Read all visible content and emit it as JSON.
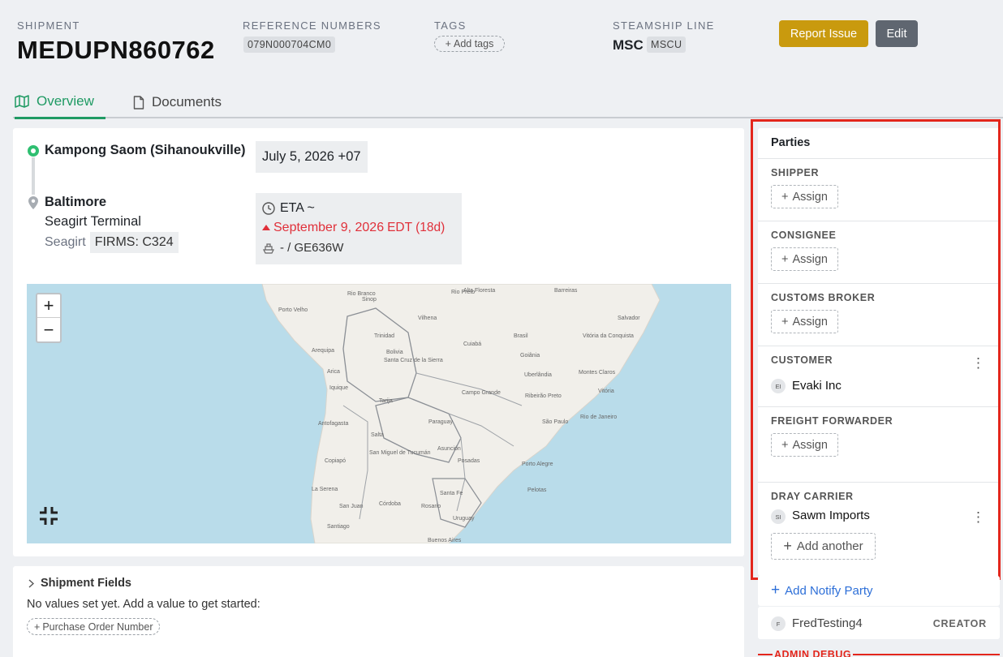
{
  "header": {
    "shipment_label": "SHIPMENT",
    "shipment_number": "MEDUPN860762",
    "reference_label": "REFERENCE NUMBERS",
    "reference_value": "079N000704CM0",
    "tags_label": "TAGS",
    "add_tags": "Add tags",
    "steamship_label": "STEAMSHIP LINE",
    "steamship_name": "MSC",
    "steamship_code": "MSCU",
    "report_button": "Report Issue",
    "edit_button": "Edit"
  },
  "tabs": [
    {
      "label": "Overview",
      "icon": "map-icon",
      "active": true
    },
    {
      "label": "Documents",
      "icon": "document-icon",
      "active": false
    }
  ],
  "route": {
    "origin": "Kampong Saom (Sihanoukville)",
    "departure_date": "July 5, 2026 +07",
    "destination": "Baltimore",
    "terminal": "Seagirt Terminal",
    "terminal_short": "Seagirt",
    "firms": "FIRMS: C324",
    "eta_label": "ETA ~",
    "eta_date": "September 9, 2026",
    "eta_tz_delay": "EDT (18d)",
    "vessel": "- / GE636W",
    "colors": {
      "origin": "#2fbf71",
      "delay": "#e0303a"
    }
  },
  "map": {
    "zoom_in": "+",
    "zoom_out": "−",
    "labels": [
      "Rio Branco",
      "Porto Velho",
      "Rio Preto",
      "Alta Floresta",
      "Barreiras",
      "Salvador",
      "Sinop",
      "Vilhena",
      "Brasil",
      "Vitória da Conquista",
      "Trinidad",
      "Cuiabá",
      "Goiânia",
      "Montes Claros",
      "Bolivia",
      "Santa Cruz de la Sierra",
      "Uberlândia",
      "Arequipa",
      "Arica",
      "Campo Grande",
      "Ribeirão Preto",
      "Vitória",
      "Iquique",
      "Tarija",
      "Rio de Janeiro",
      "Antofagasta",
      "Paraguay",
      "São Paulo",
      "Salta",
      "Asunción",
      "Copiapó",
      "San Miguel de Tucumán",
      "Posadas",
      "Porto Alegre",
      "La Serena",
      "Córdoba",
      "Rosario",
      "Santa Fe",
      "Pelotas",
      "Uruguay",
      "San Juan",
      "Santiago",
      "Buenos Aires"
    ]
  },
  "shipment_fields": {
    "title": "Shipment Fields",
    "empty_text": "No values set yet. Add a value to get started:",
    "add_po": "Purchase Order Number"
  },
  "parties": {
    "title": "Parties",
    "assign_label": "Assign",
    "shipper": "SHIPPER",
    "consignee": "CONSIGNEE",
    "customs_broker": "CUSTOMS BROKER",
    "customer": "CUSTOMER",
    "customer_initials": "EI",
    "customer_name": "Evaki Inc",
    "freight_forwarder": "FREIGHT FORWARDER",
    "dray_carrier": "DRAY CARRIER",
    "dray_initials": "SI",
    "dray_name": "Sawm Imports",
    "add_another": "Add another",
    "add_notify": "Add Notify Party",
    "creator_initial": "F",
    "creator_name": "FredTesting4",
    "creator_role": "CREATOR",
    "admin_debug": "ADMIN DEBUG"
  }
}
